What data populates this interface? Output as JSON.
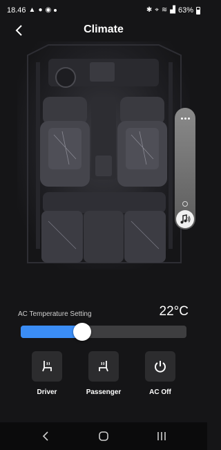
{
  "status_bar": {
    "time": "18.46",
    "battery": "63%",
    "left_icons": [
      "warning-icon",
      "facebook-icon",
      "messenger-icon"
    ],
    "right_icons": [
      "bluetooth-icon",
      "location-icon",
      "wifi-icon",
      "signal-icon",
      "battery-icon"
    ]
  },
  "header": {
    "title": "Climate"
  },
  "side_panel": {
    "icons": [
      "more-dots-icon",
      "small-circle-icon",
      "music-icon"
    ]
  },
  "temperature": {
    "label": "AC Temperature Setting",
    "value": "22°C",
    "slider_fraction": 0.37
  },
  "controls": [
    {
      "label": "Driver",
      "icon": "heated-seat-icon"
    },
    {
      "label": "Passenger",
      "icon": "heated-seat-icon"
    },
    {
      "label": "AC Off",
      "icon": "power-icon"
    }
  ],
  "colors": {
    "background": "#151517",
    "accent": "#3b8df6",
    "control_bg": "#2c2c2e"
  },
  "nav_bar": {
    "icons": [
      "back-icon",
      "home-icon",
      "recents-icon"
    ]
  }
}
